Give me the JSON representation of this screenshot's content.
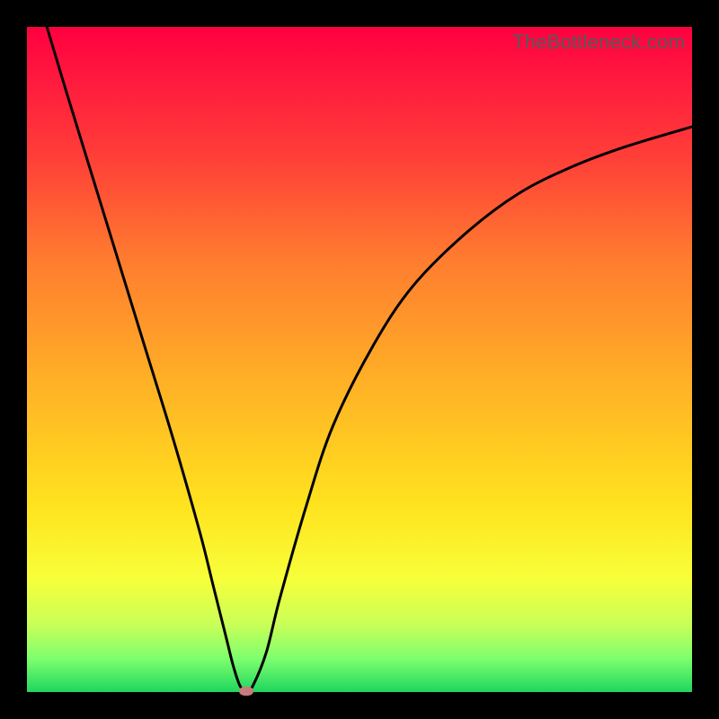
{
  "watermark": "TheBottleneck.com",
  "chart_data": {
    "type": "line",
    "title": "",
    "xlabel": "",
    "ylabel": "",
    "xlim": [
      0,
      100
    ],
    "ylim": [
      0,
      100
    ],
    "grid": false,
    "series": [
      {
        "name": "curve",
        "x": [
          3,
          6,
          10,
          14,
          18,
          22,
          26,
          28,
          30,
          31,
          32,
          33,
          34,
          36,
          38,
          42,
          46,
          52,
          58,
          66,
          74,
          82,
          90,
          100
        ],
        "y": [
          100,
          90,
          77,
          64,
          51,
          38,
          24,
          16,
          8,
          4,
          1,
          0,
          1,
          6,
          14,
          28,
          40,
          52,
          61,
          69,
          75,
          79,
          82,
          85
        ]
      }
    ],
    "marker": {
      "x": 33,
      "y": 0,
      "color": "#c87b7b"
    },
    "background_gradient": [
      "#ff0040",
      "#ff7c2f",
      "#ffe31e",
      "#1fd65e"
    ]
  }
}
